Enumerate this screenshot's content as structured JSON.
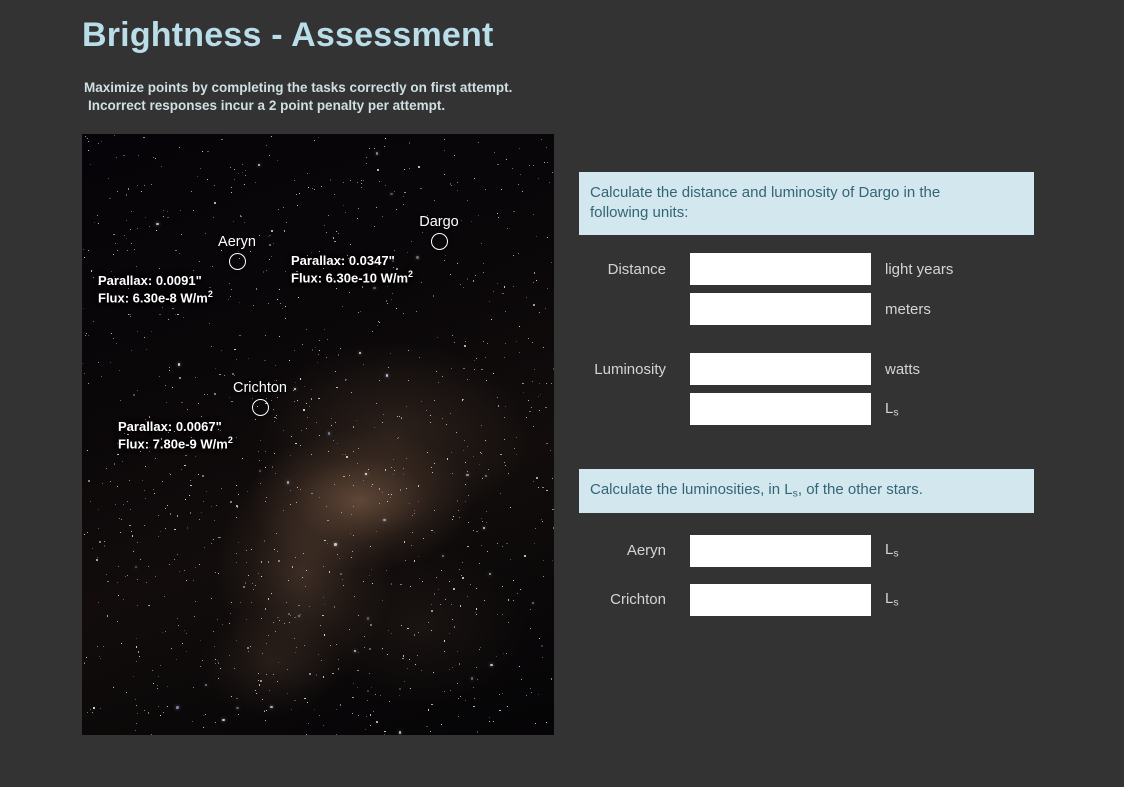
{
  "page": {
    "title": "Brightness - Assessment",
    "instructions_line1": "Maximize points by completing the tasks correctly on first attempt.",
    "instructions_line2": "Incorrect responses incur a 2 point penalty per attempt.",
    "background_color": "#333333",
    "title_color": "#b9dde9",
    "banner_bg_color": "#d3e7ef",
    "banner_text_color": "#346575"
  },
  "starfield": {
    "stars": [
      {
        "name": "Aeryn",
        "parallax_label": "Parallax:  0.0091\"",
        "flux_label_pre": "Flux:  6.30e-8 W/m",
        "flux_exponent": "2"
      },
      {
        "name": "Dargo",
        "parallax_label": "Parallax:  0.0347\"",
        "flux_label_pre": "Flux:  6.30e-10 W/m",
        "flux_exponent": "2"
      },
      {
        "name": "Crichton",
        "parallax_label": "Parallax:  0.0067\"",
        "flux_label_pre": "Flux:  7.80e-9 W/m",
        "flux_exponent": "2"
      }
    ]
  },
  "question1": {
    "banner_line1": "Calculate the distance and luminosity of Dargo in the",
    "banner_line2": "following units:",
    "rows": [
      {
        "label": "Distance",
        "value": "",
        "unit_text": "light years",
        "unit_sub": ""
      },
      {
        "label": "",
        "value": "",
        "unit_text": "meters",
        "unit_sub": ""
      },
      {
        "label": "Luminosity",
        "value": "",
        "unit_text": "watts",
        "unit_sub": ""
      },
      {
        "label": "",
        "value": "",
        "unit_text": "L",
        "unit_sub": "s"
      }
    ]
  },
  "question2": {
    "banner_pre": "Calculate the luminosities, in L",
    "banner_sub": "s",
    "banner_post": ", of the other stars.",
    "rows": [
      {
        "label": "Aeryn",
        "value": "",
        "unit_text": "L",
        "unit_sub": "s"
      },
      {
        "label": "Crichton",
        "value": "",
        "unit_text": "L",
        "unit_sub": "s"
      }
    ]
  }
}
